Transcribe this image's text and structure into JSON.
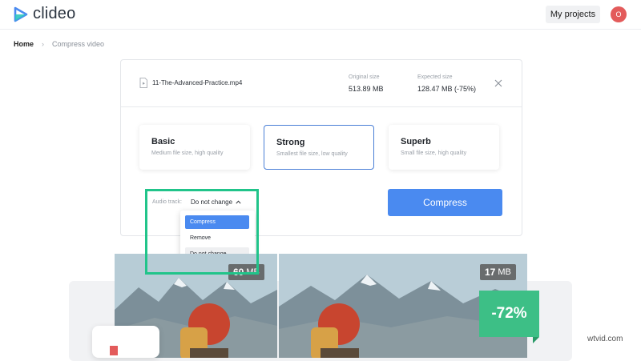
{
  "header": {
    "logo_text": "clideo",
    "my_projects_label": "My projects",
    "avatar_initial": "O"
  },
  "breadcrumb": {
    "home": "Home",
    "separator": "›",
    "current": "Compress video"
  },
  "file": {
    "name": "11-The-Advanced-Practice.mp4",
    "original_size_label": "Original size",
    "original_size_value": "513.89 MB",
    "expected_size_label": "Expected size",
    "expected_size_value": "128.47 MB (-75%)"
  },
  "options": [
    {
      "title": "Basic",
      "subtitle": "Medium file size, high quality",
      "selected": false
    },
    {
      "title": "Strong",
      "subtitle": "Smallest file size, low quality",
      "selected": true
    },
    {
      "title": "Superb",
      "subtitle": "Small file size, high quality",
      "selected": false
    }
  ],
  "audio": {
    "label": "Audio track:",
    "value": "Do not change",
    "dropdown_items": [
      "Compress",
      "Remove",
      "Do not change"
    ],
    "active_item": "Compress"
  },
  "compress_button_label": "Compress",
  "previews": {
    "left_size_number": "60",
    "right_size_number": "17",
    "size_unit": "MB",
    "reduction_label": "-72%"
  },
  "watermark": "wtvid.com",
  "colors": {
    "accent_blue": "#4a8af0",
    "selected_border": "#4a7fd6",
    "highlight_green": "#21c48a",
    "badge_green": "#3dbf86",
    "avatar_red": "#e35b5b"
  }
}
